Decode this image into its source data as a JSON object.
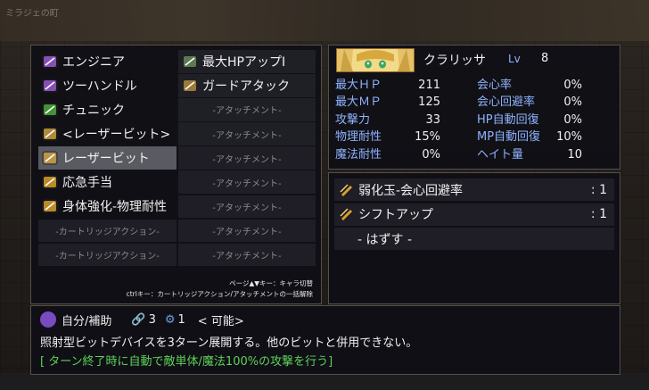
{
  "background": {
    "map_title": "ミラジェの町"
  },
  "skills": {
    "left": [
      {
        "label": "エンジニア",
        "icon": "engineer-icon",
        "color": "#9a5ad0"
      },
      {
        "label": "ツーハンドル",
        "icon": "two-handle-icon",
        "color": "#9a5ad0"
      },
      {
        "label": "チュニック",
        "icon": "tunic-icon",
        "color": "#4caa3c"
      },
      {
        "label": "<レーザービット>",
        "icon": "laser-bit-icon",
        "color": "#caa040"
      },
      {
        "label": "レーザービット",
        "icon": "laser-bit-icon",
        "color": "#caa040",
        "selected": true
      },
      {
        "label": "応急手当",
        "icon": "cartridge-icon",
        "color": "#d9a02c"
      },
      {
        "label": "身体強化-物理耐性",
        "icon": "cartridge-icon",
        "color": "#d9a02c"
      },
      {
        "label": "-カートリッジアクション-",
        "empty": true
      },
      {
        "label": "-カートリッジアクション-",
        "empty": true
      }
    ],
    "right": [
      {
        "label": "最大HPアップⅠ",
        "icon": "hp-up-icon",
        "color": "#6a8a5a"
      },
      {
        "label": "ガードアタック",
        "icon": "guard-attack-icon",
        "color": "#b08a40"
      },
      {
        "label": "-アタッチメント-",
        "empty": true
      },
      {
        "label": "-アタッチメント-",
        "empty": true
      },
      {
        "label": "-アタッチメント-",
        "empty": true
      },
      {
        "label": "-アタッチメント-",
        "empty": true
      },
      {
        "label": "-アタッチメント-",
        "empty": true
      },
      {
        "label": "-アタッチメント-",
        "empty": true
      },
      {
        "label": "-アタッチメント-",
        "empty": true
      }
    ],
    "hint1": "ページ▲▼キー：キャラ切替",
    "hint2": "ctrlキー：カートリッジアクション/アタッチメントの一括解除"
  },
  "status": {
    "name": "クラリッサ",
    "lv_label": "Lv",
    "lv": "8",
    "left": [
      {
        "label": "最大ＨＰ",
        "value": "211"
      },
      {
        "label": "最大ＭＰ",
        "value": "125"
      },
      {
        "label": "攻撃力",
        "value": "33"
      },
      {
        "label": "物理耐性",
        "value": "15%"
      },
      {
        "label": "魔法耐性",
        "value": "0%"
      }
    ],
    "right": [
      {
        "label": "会心率",
        "value": "0%"
      },
      {
        "label": "会心回避率",
        "value": "0%"
      },
      {
        "label": "HP自動回復",
        "value": "0%"
      },
      {
        "label": "MP自動回復",
        "value": "10%"
      },
      {
        "label": "ヘイト量",
        "value": "10"
      }
    ]
  },
  "gems": [
    {
      "label": "弱化玉-会心回避率",
      "qty": ": 1"
    },
    {
      "label": "シフトアップ",
      "qty": ": 1"
    },
    {
      "label": "- はずす -"
    }
  ],
  "desc": {
    "target": "自分/補助",
    "cost1": "3",
    "cost2": "1",
    "status": "<  可能>",
    "line1": "照射型ビットデバイスを3ターン展開する。他のビットと併用できない。",
    "line2": "[ ターン終了時に自動で敵単体/魔法100%の攻撃を行う]",
    "line2_color": "#5fd15a"
  }
}
